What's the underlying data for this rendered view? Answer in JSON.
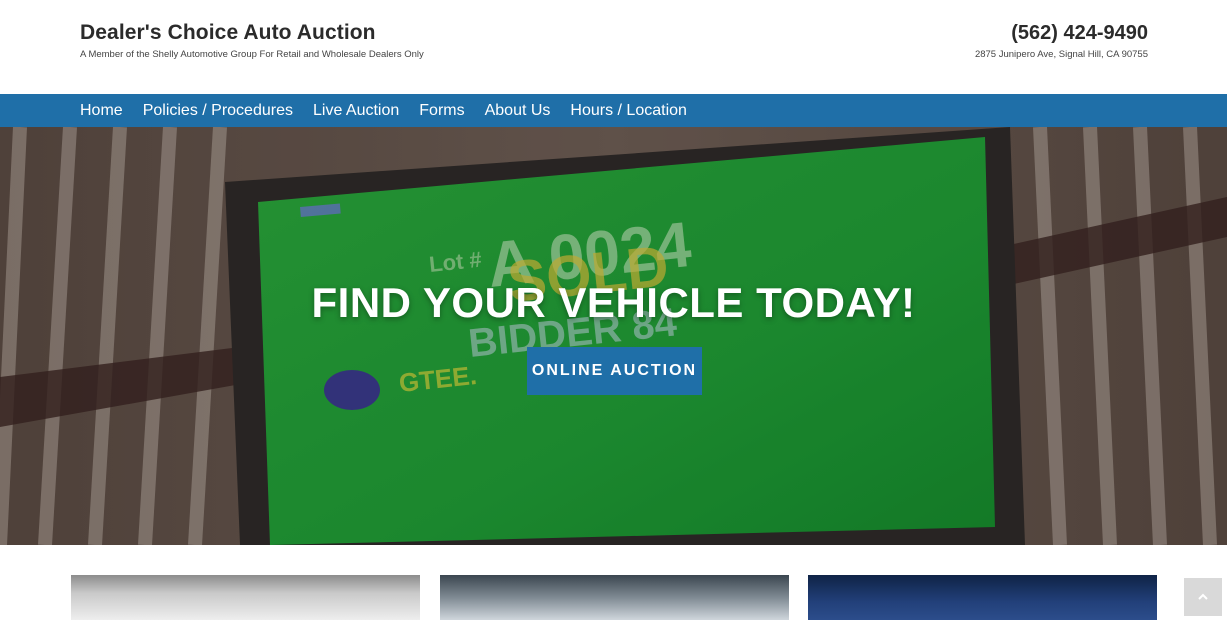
{
  "header": {
    "title": "Dealer's Choice Auto Auction",
    "tagline": "A Member of the Shelly Automotive Group For Retail and Wholesale Dealers Only",
    "phone": "(562) 424-9490",
    "address": "2875 Junipero Ave, Signal Hill, CA 90755"
  },
  "nav": {
    "items": [
      {
        "label": "Home"
      },
      {
        "label": "Policies / Procedures"
      },
      {
        "label": "Live Auction"
      },
      {
        "label": "Forms"
      },
      {
        "label": "About Us"
      },
      {
        "label": "Hours / Location"
      }
    ]
  },
  "hero": {
    "title": "FIND YOUR VEHICLE TODAY!",
    "button_label": "ONLINE AUCTION"
  },
  "colors": {
    "nav_background": "#1f6fa8",
    "button_background": "#1f6fa8"
  },
  "icons": {
    "scroll_top": "chevron-up-icon"
  }
}
